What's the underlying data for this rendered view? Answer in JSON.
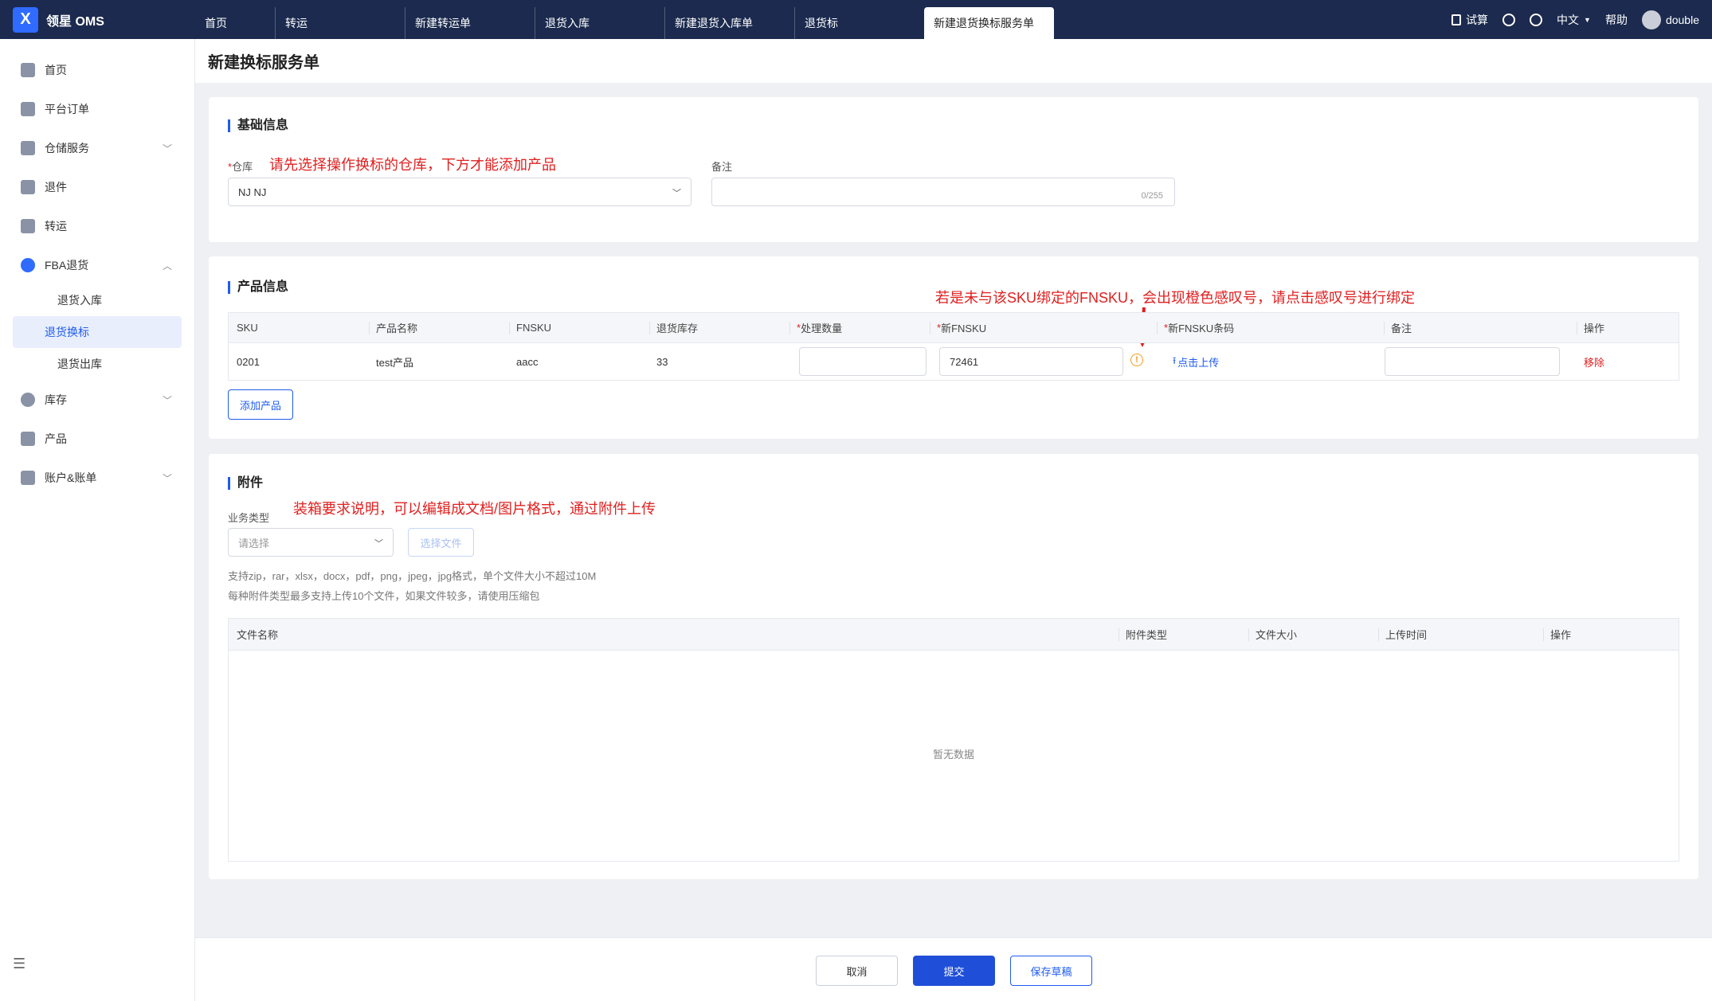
{
  "app": {
    "name": "领星 OMS",
    "logo_glyph": "X"
  },
  "tabs": [
    {
      "label": "首页"
    },
    {
      "label": "转运"
    },
    {
      "label": "新建转运单"
    },
    {
      "label": "退货入库"
    },
    {
      "label": "新建退货入库单"
    },
    {
      "label": "退货标"
    },
    {
      "label": "新建退货换标服务单"
    }
  ],
  "topbar": {
    "trial": "试算",
    "language": "中文",
    "help": "帮助",
    "user": "double"
  },
  "sidebar": {
    "items": [
      {
        "label": "首页"
      },
      {
        "label": "平台订单"
      },
      {
        "label": "仓储服务"
      },
      {
        "label": "退件"
      },
      {
        "label": "转运"
      },
      {
        "label": "FBA退货"
      },
      {
        "label": "库存"
      },
      {
        "label": "产品"
      },
      {
        "label": "账户&账单"
      }
    ],
    "sub_items": [
      {
        "label": "退货入库"
      },
      {
        "label": "退货换标"
      },
      {
        "label": "退货出库"
      }
    ]
  },
  "page": {
    "title": "新建换标服务单"
  },
  "basic": {
    "title": "基础信息",
    "warehouse_label": "仓库",
    "warehouse_value": "NJ NJ",
    "remark_label": "备注",
    "remark_count": "0/255",
    "annotation": "请先选择操作换标的仓库，下方才能添加产品"
  },
  "product": {
    "title": "产品信息",
    "annotation": "若是未与该SKU绑定的FNSKU，会出现橙色感叹号，请点击感叹号进行绑定",
    "columns": {
      "sku": "SKU",
      "name": "产品名称",
      "fnsku": "FNSKU",
      "stock": "退货库存",
      "qty": "处理数量",
      "new_fnsku": "新FNSKU",
      "barcode": "新FNSKU条码",
      "remark": "备注",
      "action": "操作"
    },
    "row": {
      "sku": "0201",
      "name": "test产品",
      "fnsku": "aacc",
      "stock": "33",
      "qty": "",
      "new_fnsku": "72461",
      "upload": "点击上传",
      "remove": "移除"
    },
    "add_button": "添加产品"
  },
  "attachment": {
    "title": "附件",
    "annotation": "装箱要求说明，可以编辑成文档/图片格式，通过附件上传",
    "type_label": "业务类型",
    "type_placeholder": "请选择",
    "choose_file": "选择文件",
    "hint1": "支持zip，rar，xlsx，docx，pdf，png，jpeg，jpg格式，单个文件大小不超过10M",
    "hint2": "每种附件类型最多支持上传10个文件，如果文件较多，请使用压缩包",
    "columns": {
      "file_name": "文件名称",
      "type": "附件类型",
      "size": "文件大小",
      "time": "上传时间",
      "action": "操作"
    },
    "empty": "暂无数据"
  },
  "footer": {
    "cancel": "取消",
    "submit": "提交",
    "save_draft": "保存草稿"
  },
  "colors": {
    "topbar": "#1b2a4e",
    "primary": "#1f4fd8",
    "annotation": "#e02020",
    "warning": "#f59a23"
  }
}
